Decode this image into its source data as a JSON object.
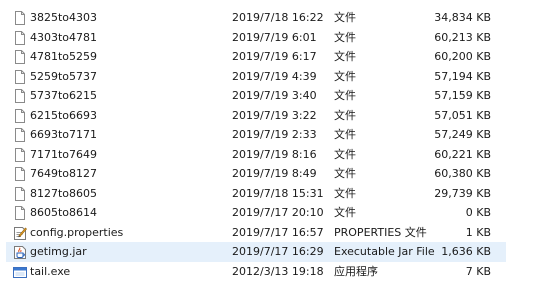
{
  "files": [
    {
      "name": "3825to4303",
      "date": "2019/7/18 16:22",
      "type": "文件",
      "size": "34,834 KB",
      "icon": "file-icon"
    },
    {
      "name": "4303to4781",
      "date": "2019/7/19 6:01",
      "type": "文件",
      "size": "60,213 KB",
      "icon": "file-icon"
    },
    {
      "name": "4781to5259",
      "date": "2019/7/19 6:17",
      "type": "文件",
      "size": "60,200 KB",
      "icon": "file-icon"
    },
    {
      "name": "5259to5737",
      "date": "2019/7/19 4:39",
      "type": "文件",
      "size": "57,194 KB",
      "icon": "file-icon"
    },
    {
      "name": "5737to6215",
      "date": "2019/7/19 3:40",
      "type": "文件",
      "size": "57,159 KB",
      "icon": "file-icon"
    },
    {
      "name": "6215to6693",
      "date": "2019/7/19 3:22",
      "type": "文件",
      "size": "57,051 KB",
      "icon": "file-icon"
    },
    {
      "name": "6693to7171",
      "date": "2019/7/19 2:33",
      "type": "文件",
      "size": "57,249 KB",
      "icon": "file-icon"
    },
    {
      "name": "7171to7649",
      "date": "2019/7/19 8:16",
      "type": "文件",
      "size": "60,221 KB",
      "icon": "file-icon"
    },
    {
      "name": "7649to8127",
      "date": "2019/7/19 8:49",
      "type": "文件",
      "size": "60,380 KB",
      "icon": "file-icon"
    },
    {
      "name": "8127to8605",
      "date": "2019/7/18 15:31",
      "type": "文件",
      "size": "29,739 KB",
      "icon": "file-icon"
    },
    {
      "name": "8605to8614",
      "date": "2019/7/17 20:10",
      "type": "文件",
      "size": "0 KB",
      "icon": "file-icon"
    },
    {
      "name": "config.properties",
      "date": "2019/7/17 16:57",
      "type": "PROPERTIES 文件",
      "size": "1 KB",
      "icon": "properties-file-icon"
    },
    {
      "name": "getimg.jar",
      "date": "2019/7/17 16:29",
      "type": "Executable Jar File",
      "size": "1,636 KB",
      "icon": "jar-file-icon",
      "selected": true
    },
    {
      "name": "tail.exe",
      "date": "2012/3/13 19:18",
      "type": "应用程序",
      "size": "7 KB",
      "icon": "exe-file-icon"
    }
  ],
  "colors": {
    "selection": "#e5f0fb",
    "text": "#1a1a1a"
  }
}
